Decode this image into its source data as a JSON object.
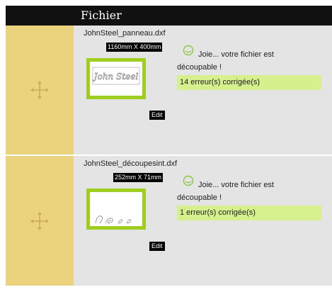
{
  "header": {
    "title": "Fichier"
  },
  "files": [
    {
      "filename": "JohnSteel_panneau.dxf",
      "dimensions": "1160mm X 400mm",
      "status": "Joie... votre fichier est découpable !",
      "errors": "14 erreur(s) corrigée(s)",
      "edit_label": "Edit",
      "preview_text": "John Steel"
    },
    {
      "filename": "JohnSteel_découpesint.dxf",
      "dimensions": "252mm X 71mm",
      "status": "Joie... votre fichier est découpable !",
      "errors": "1 erreur(s) corrigée(s)",
      "edit_label": "Edit"
    }
  ],
  "colors": {
    "header_bg": "#111111",
    "drag_column": "#ebd27d",
    "content_bg": "#e4e4e4",
    "preview_border": "#9ecf1e",
    "success_bg": "#d7f08e",
    "icon_green": "#8cc63f"
  },
  "icons": [
    "move-icon",
    "smile-icon"
  ]
}
